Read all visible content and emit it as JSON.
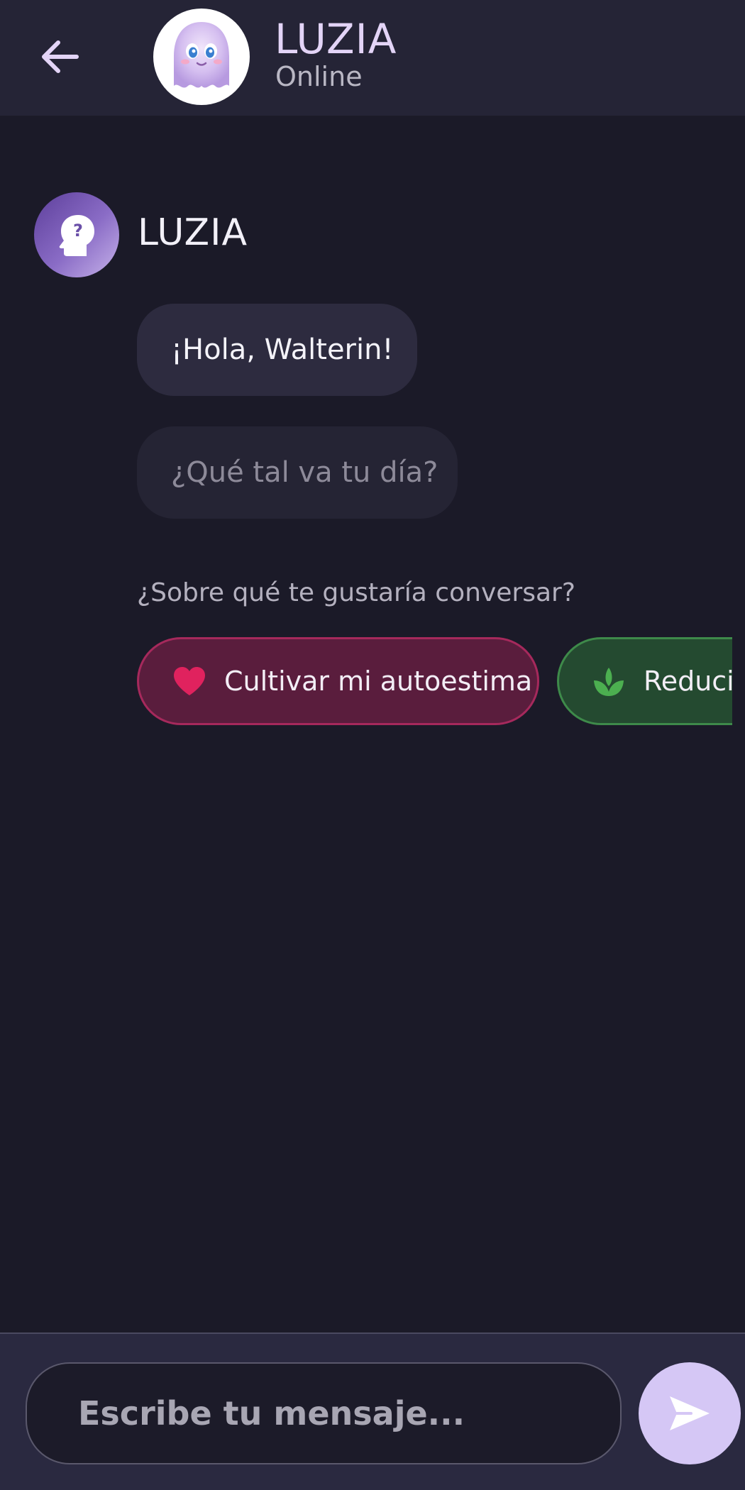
{
  "header": {
    "title": "LUZIA",
    "status": "Online",
    "back_icon": "arrow-left-icon",
    "avatar_icon": "ghost-mascot-icon"
  },
  "bot": {
    "name": "LUZIA",
    "avatar_icon": "head-question-icon"
  },
  "messages": [
    {
      "text": "¡Hola, Walterin!"
    },
    {
      "text": "¿Qué tal va tu día?"
    }
  ],
  "prompt": "¿Sobre qué te gustaría conversar?",
  "chips": [
    {
      "label": "Cultivar mi autoestima",
      "icon": "heart-icon",
      "color": "#e0225e"
    },
    {
      "label": "Reducir",
      "icon": "sprout-icon",
      "color": "#4caf50"
    }
  ],
  "composer": {
    "placeholder": "Escribe tu mensaje...",
    "send_icon": "send-icon"
  },
  "colors": {
    "background": "#1b1a28",
    "header": "#252436",
    "accent": "#d5c7f5"
  }
}
